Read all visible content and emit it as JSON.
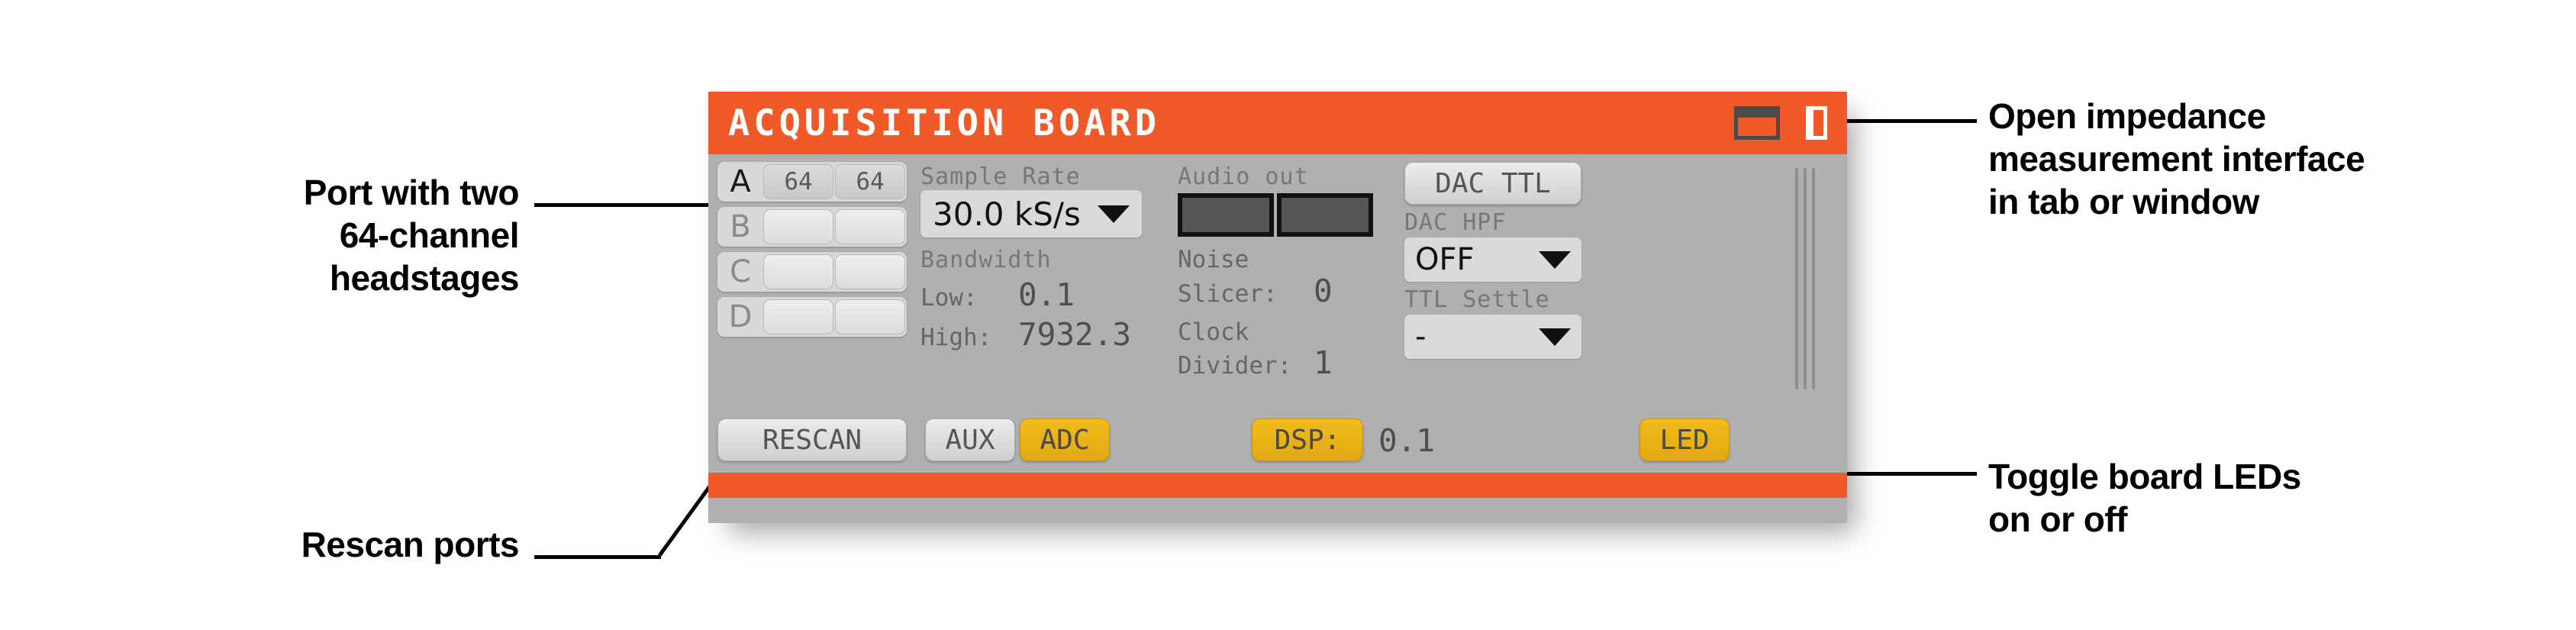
{
  "panel": {
    "title": "ACQUISITION BOARD",
    "titlebar_color": "#ef5a28",
    "body_color": "#b0b0b0",
    "accent_gold": "#e8b317",
    "icons": {
      "tab_icon": "tab-icon",
      "window_icon": "window-icon"
    }
  },
  "ports": {
    "rows": [
      {
        "letter": "A",
        "active": true,
        "headstages": [
          "64",
          "64"
        ]
      },
      {
        "letter": "B",
        "active": false,
        "headstages": [
          "",
          ""
        ]
      },
      {
        "letter": "C",
        "active": false,
        "headstages": [
          "",
          ""
        ]
      },
      {
        "letter": "D",
        "active": false,
        "headstages": [
          "",
          ""
        ]
      }
    ]
  },
  "sample_rate": {
    "label": "Sample Rate",
    "value": "30.0 kS/s"
  },
  "bandwidth": {
    "label": "Bandwidth",
    "low_label": "Low:",
    "low_value": "0.1",
    "high_label": "High:",
    "high_value": "7932.3"
  },
  "audio_out": {
    "label": "Audio out",
    "channels": [
      "",
      ""
    ]
  },
  "noise_slicer": {
    "label_line1": "Noise",
    "label_line2": "Slicer:",
    "value": "0"
  },
  "clock_divider": {
    "label_line1": "Clock",
    "label_line2": "Divider:",
    "value": "1"
  },
  "dac": {
    "ttl_button": "DAC TTL",
    "hpf_label": "DAC HPF",
    "hpf_value": "OFF",
    "ttl_settle_label": "TTL Settle",
    "ttl_settle_value": "-"
  },
  "bottom": {
    "rescan": "RESCAN",
    "aux": "AUX",
    "adc": "ADC",
    "dsp": "DSP:",
    "dsp_value": "0.1",
    "led": "LED"
  },
  "annotations": {
    "port": "Port with two\n64-channel\nheadstages",
    "rescan": "Rescan ports",
    "impedance": "Open impedance\nmeasurement interface\nin tab or window",
    "led": "Toggle board LEDs\non or off"
  }
}
